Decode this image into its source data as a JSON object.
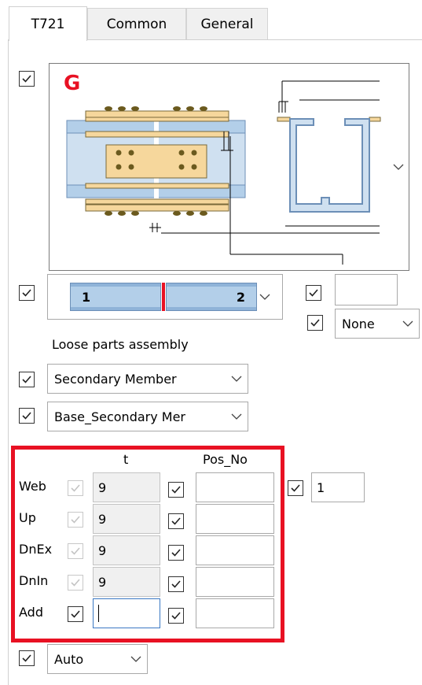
{
  "tabs": [
    {
      "label": "T721",
      "active": true
    },
    {
      "label": "Common",
      "active": false
    },
    {
      "label": "General",
      "active": false
    }
  ],
  "preview": {
    "letter": "G",
    "letter_color": "#e81123",
    "plate_color": "#f6d79c",
    "beam_color": "#b3cfe9",
    "outline_color": "#6c8fb7"
  },
  "splice_selector": {
    "left_label": "1",
    "right_label": "2",
    "divider_color": "#e81123"
  },
  "right_field_value": "",
  "none_dropdown": {
    "value": "None"
  },
  "loose_parts_label": "Loose parts assembly",
  "member_dropdown": {
    "value": "Secondary Member"
  },
  "base_dropdown": {
    "value": "Base_Secondary Mer"
  },
  "table": {
    "col_t": "t",
    "col_pos": "Pos_No",
    "rows": [
      {
        "label": "Web",
        "t": "9",
        "pos": ""
      },
      {
        "label": "Up",
        "t": "9",
        "pos": ""
      },
      {
        "label": "DnEx",
        "t": "9",
        "pos": ""
      },
      {
        "label": "DnIn",
        "t": "9",
        "pos": ""
      },
      {
        "label": "Add",
        "t": "",
        "pos": ""
      }
    ],
    "extra_value": "1"
  },
  "auto_dropdown": {
    "value": "Auto"
  }
}
